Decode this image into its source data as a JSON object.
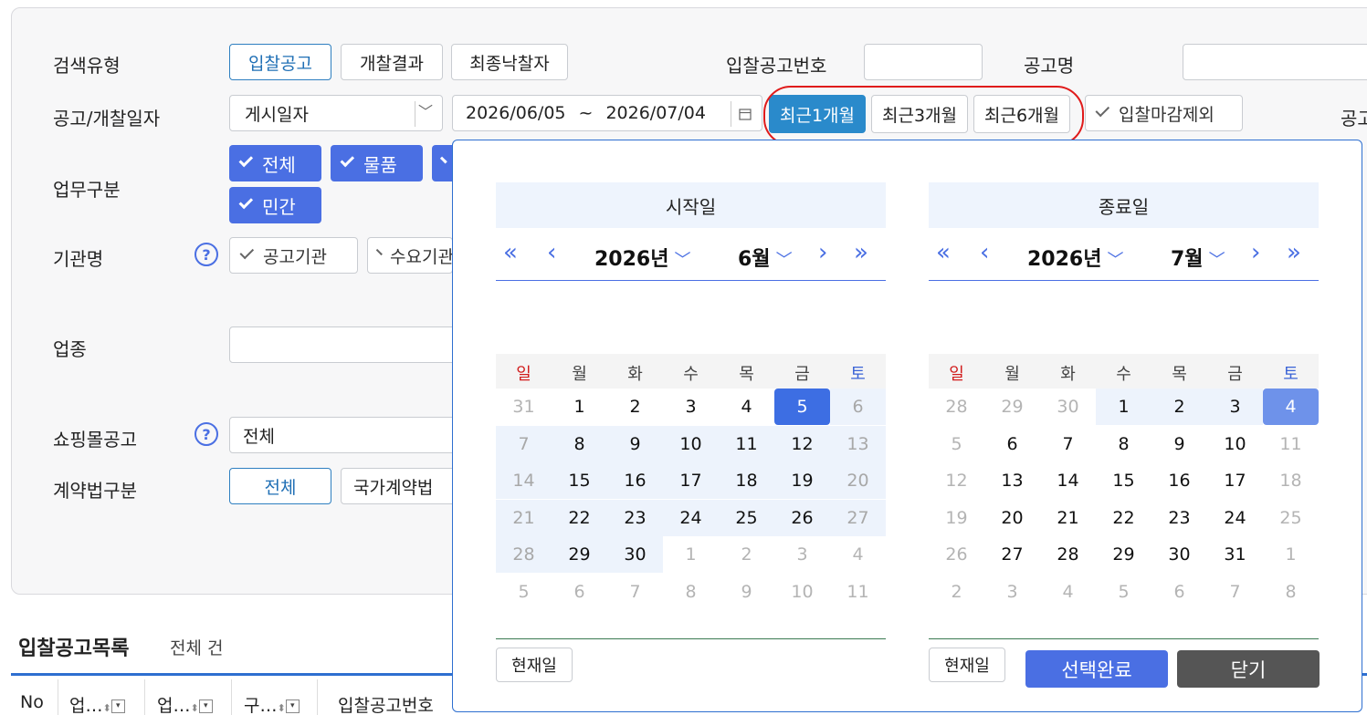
{
  "search": {
    "search_type_label": "검색유형",
    "search_type_options": [
      "입찰공고",
      "개찰결과",
      "최종낙찰자"
    ],
    "notice_no_label": "입찰공고번호",
    "notice_no_value": "",
    "notice_name_label": "공고명",
    "notice_name_value": "",
    "date_label": "공고/개찰일자",
    "date_kind_value": "게시일자",
    "date_from": "2026/06/05",
    "date_sep": "~",
    "date_to": "2026/07/04",
    "quick_periods": [
      "최근1개월",
      "최근3개월",
      "최근6개월"
    ],
    "exclude_closed_label": "입찰마감제외",
    "right_cut_label": "공고",
    "business_label": "업무구분",
    "business_options": [
      "전체",
      "물품",
      "민간"
    ],
    "agency_label": "기관명",
    "agency_options": [
      "공고기관",
      "수요기관"
    ],
    "industry_label": "업종",
    "industry_value": "",
    "mall_label": "쇼핑몰공고",
    "mall_value": "전체",
    "contract_law_label": "계약법구분",
    "contract_law_options": [
      "전체",
      "국가계약법"
    ]
  },
  "list": {
    "title": "입찰공고목록",
    "count_text": "전체 건",
    "columns": [
      "No",
      "업…",
      "업…",
      "구…",
      "입찰공고번호"
    ]
  },
  "datepicker": {
    "start": {
      "title": "시작일",
      "year": "2026년",
      "month": "6월",
      "weekdays": [
        "일",
        "월",
        "화",
        "수",
        "목",
        "금",
        "토"
      ],
      "days": [
        "31",
        "1",
        "2",
        "3",
        "4",
        "5",
        "6",
        "7",
        "8",
        "9",
        "10",
        "11",
        "12",
        "13",
        "14",
        "15",
        "16",
        "17",
        "18",
        "19",
        "20",
        "21",
        "22",
        "23",
        "24",
        "25",
        "26",
        "27",
        "28",
        "29",
        "30",
        "1",
        "2",
        "3",
        "4",
        "5",
        "6",
        "7",
        "8",
        "9",
        "10",
        "11"
      ],
      "selected_day": "5"
    },
    "end": {
      "title": "종료일",
      "year": "2026년",
      "month": "7월",
      "weekdays": [
        "일",
        "월",
        "화",
        "수",
        "목",
        "금",
        "토"
      ],
      "days": [
        "28",
        "29",
        "30",
        "1",
        "2",
        "3",
        "4",
        "5",
        "6",
        "7",
        "8",
        "9",
        "10",
        "11",
        "12",
        "13",
        "14",
        "15",
        "16",
        "17",
        "18",
        "19",
        "20",
        "21",
        "22",
        "23",
        "24",
        "25",
        "26",
        "27",
        "28",
        "29",
        "30",
        "31",
        "1",
        "2",
        "3",
        "4",
        "5",
        "6",
        "7",
        "8"
      ],
      "selected_day": "4"
    },
    "today_label": "현재일",
    "confirm_label": "선택완료",
    "close_label": "닫기"
  },
  "colors": {
    "primary": "#4a6fe3",
    "active_quick": "#2a8acb",
    "highlight_ring": "#e01b1b",
    "sunday": "#d11d1d",
    "saturday": "#3a63d6",
    "close_button": "#555555"
  }
}
